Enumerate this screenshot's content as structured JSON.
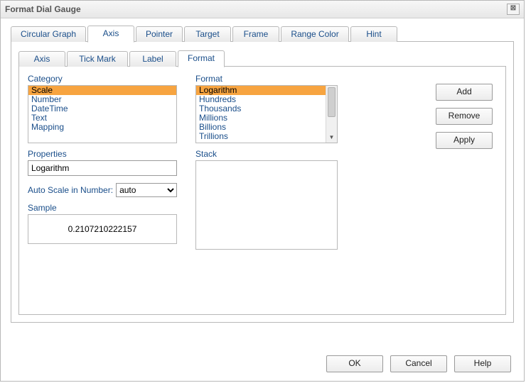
{
  "window": {
    "title": "Format Dial Gauge",
    "close_glyph": "⊠"
  },
  "main_tabs": {
    "items": [
      {
        "label": "Circular Graph"
      },
      {
        "label": "Axis"
      },
      {
        "label": "Pointer"
      },
      {
        "label": "Target"
      },
      {
        "label": "Frame"
      },
      {
        "label": "Range Color"
      },
      {
        "label": "Hint"
      }
    ],
    "active_index": 1
  },
  "sub_tabs": {
    "items": [
      {
        "label": "Axis"
      },
      {
        "label": "Tick Mark"
      },
      {
        "label": "Label"
      },
      {
        "label": "Format"
      }
    ],
    "active_index": 3
  },
  "labels": {
    "category": "Category",
    "format": "Format",
    "properties": "Properties",
    "auto_scale": "Auto Scale in Number:",
    "sample": "Sample",
    "stack": "Stack"
  },
  "category_list": {
    "items": [
      "Scale",
      "Number",
      "DateTime",
      "Text",
      "Mapping"
    ],
    "selected_index": 0
  },
  "format_list": {
    "items": [
      "Logarithm",
      "Hundreds",
      "Thousands",
      "Millions",
      "Billions",
      "Trillions"
    ],
    "selected_index": 0
  },
  "properties_value": "Logarithm",
  "auto_scale": {
    "options": [
      "auto"
    ],
    "selected": "auto"
  },
  "sample_value": "0.2107210222157",
  "side_buttons": {
    "add": "Add",
    "remove": "Remove",
    "apply": "Apply"
  },
  "footer_buttons": {
    "ok": "OK",
    "cancel": "Cancel",
    "help": "Help"
  }
}
